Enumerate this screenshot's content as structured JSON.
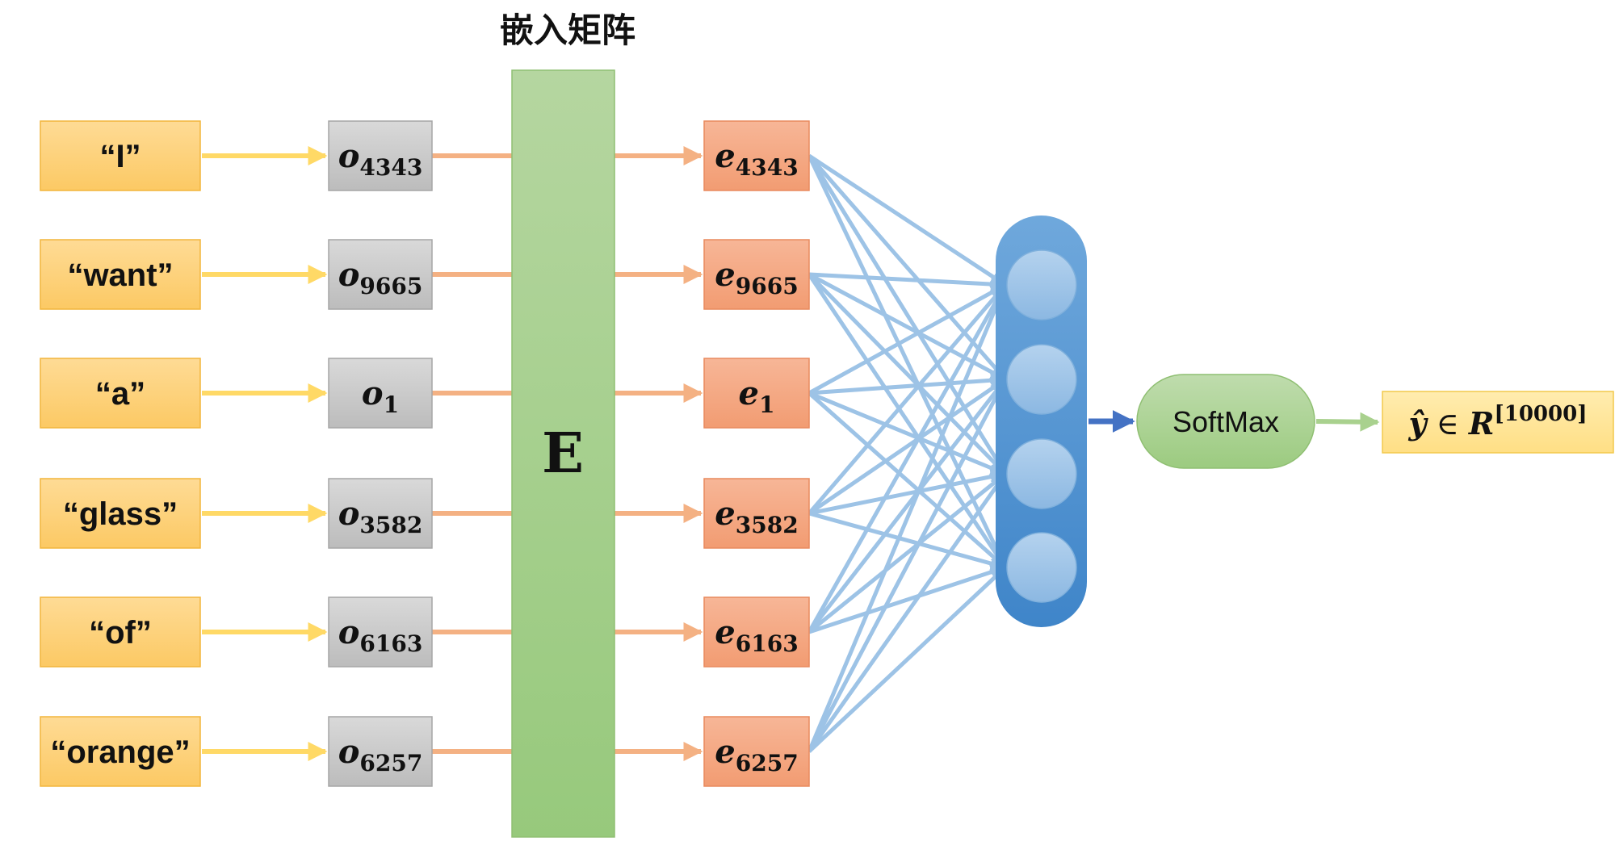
{
  "title": "嵌入矩阵",
  "words": [
    "“I”",
    "“want”",
    "“a”",
    "“glass”",
    "“of”",
    "“orange”"
  ],
  "onehot": [
    {
      "base": "o",
      "sub": "4343"
    },
    {
      "base": "o",
      "sub": "9665"
    },
    {
      "base": "o",
      "sub": "1"
    },
    {
      "base": "o",
      "sub": "3582"
    },
    {
      "base": "o",
      "sub": "6163"
    },
    {
      "base": "o",
      "sub": "6257"
    }
  ],
  "embeddings": [
    {
      "base": "e",
      "sub": "4343"
    },
    {
      "base": "e",
      "sub": "9665"
    },
    {
      "base": "e",
      "sub": "1"
    },
    {
      "base": "e",
      "sub": "3582"
    },
    {
      "base": "e",
      "sub": "6163"
    },
    {
      "base": "e",
      "sub": "6257"
    }
  ],
  "matrix_label": "E",
  "hidden_neurons": 4,
  "softmax_label": "SoftMax",
  "output": {
    "base": "ŷ",
    "rel": " ∈ ",
    "space": "R",
    "sup": "[10000]"
  },
  "colors": {
    "word_fill": "#fdd27e",
    "word_stroke": "#f2b53c",
    "onehot_fill": "#c8c8c8",
    "onehot_stroke": "#a6a6a6",
    "matrix_fill": "#a9d18e",
    "embed_fill": "#f4a582",
    "embed_stroke": "#e98a5e",
    "arrow_yellow": "#ffd966",
    "arrow_orange": "#f4b183",
    "arrow_blue_light": "#9dc3e6",
    "arrow_blue_dark": "#4472c4",
    "arrow_green": "#a9d18e",
    "layer_fill": "#5b9bd5",
    "neuron_fill": "#9dc3e6",
    "softmax_fill": "#a9d18e",
    "output_fill": "#ffe699"
  }
}
